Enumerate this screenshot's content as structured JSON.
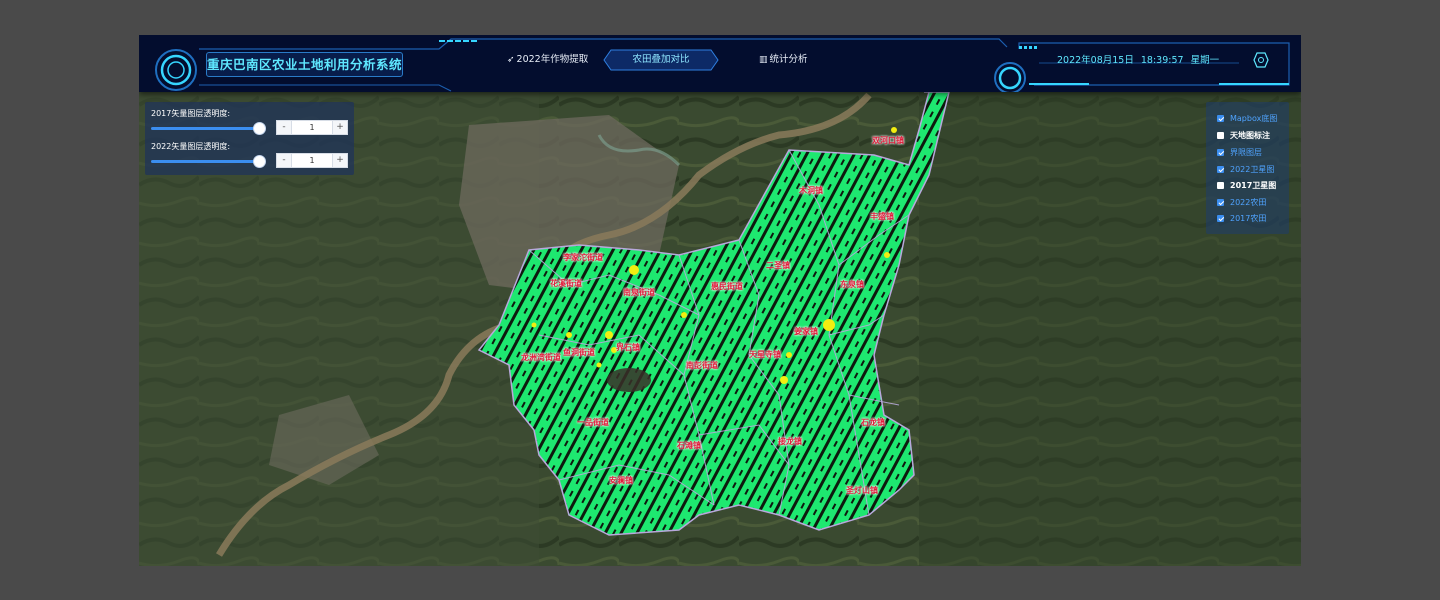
{
  "header": {
    "title": "重庆巴南区农业土地利用分析系统",
    "tabs": [
      {
        "label": "2022年作物提取",
        "icon": "paper-plane-icon",
        "active": false
      },
      {
        "label": "农田叠加对比",
        "icon": "",
        "active": true
      },
      {
        "label": "统计分析",
        "icon": "chart-icon",
        "active": false
      }
    ],
    "date": "2022年08月15日",
    "time": "18:39:57",
    "weekday": "星期一",
    "accent_color": "#5fe8ff",
    "bg_color": "#030d2e"
  },
  "opacity_panel": {
    "sliders": [
      {
        "label": "2017矢量图层透明度:",
        "value": "1",
        "fraction": 1.0
      },
      {
        "label": "2022矢量图层透明度:",
        "value": "1",
        "fraction": 1.0
      }
    ],
    "minus": "-",
    "plus": "+"
  },
  "layers": [
    {
      "label": "Mapbox底图",
      "checked": true
    },
    {
      "label": "天地图标注",
      "checked": false
    },
    {
      "label": "界限图层",
      "checked": true
    },
    {
      "label": "2022卫星图",
      "checked": true
    },
    {
      "label": "2017卫星图",
      "checked": false
    },
    {
      "label": "2022农田",
      "checked": true
    },
    {
      "label": "2017农田",
      "checked": true
    }
  ],
  "towns": [
    "南彭街道",
    "李家沱街道",
    "龙洲湾街道",
    "花溪街道",
    "鱼洞街道",
    "界石镇",
    "南泉街道",
    "一品街道",
    "安澜镇",
    "惠民街道",
    "木洞镇",
    "双河口镇",
    "麻柳嘴镇",
    "丰盛镇",
    "东泉镇",
    "姜家镇",
    "天星寺镇",
    "接龙镇",
    "石龙镇",
    "石滩镇",
    "二圣镇",
    "圣灯山镇"
  ],
  "colors": {
    "farmland_2022": "#1ee870",
    "farmland_change": "#f2ee10",
    "boundary": "#b8a8dc",
    "town_label": "#e01e3c"
  }
}
